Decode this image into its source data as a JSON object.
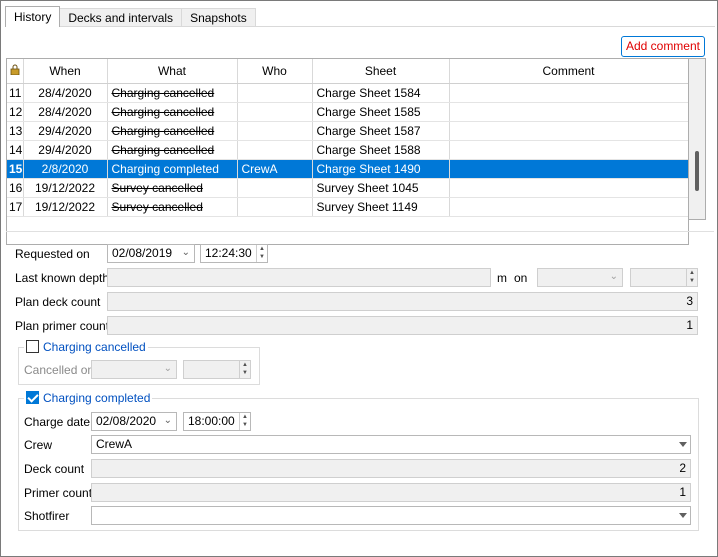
{
  "tabs": [
    {
      "label": "History",
      "active": true
    },
    {
      "label": "Decks and intervals",
      "active": false
    },
    {
      "label": "Snapshots",
      "active": false
    }
  ],
  "add_comment_label": "Add comment",
  "grid": {
    "columns": [
      "When",
      "What",
      "Who",
      "Sheet",
      "Comment"
    ],
    "rows": [
      {
        "num": "11",
        "when": "28/4/2020",
        "what": "Charging cancelled",
        "who": "",
        "sheet": "Charge Sheet 1584",
        "comment": "",
        "strike": true,
        "selected": false
      },
      {
        "num": "12",
        "when": "28/4/2020",
        "what": "Charging cancelled",
        "who": "",
        "sheet": "Charge Sheet 1585",
        "comment": "",
        "strike": true,
        "selected": false
      },
      {
        "num": "13",
        "when": "29/4/2020",
        "what": "Charging cancelled",
        "who": "",
        "sheet": "Charge Sheet 1587",
        "comment": "",
        "strike": true,
        "selected": false
      },
      {
        "num": "14",
        "when": "29/4/2020",
        "what": "Charging cancelled",
        "who": "",
        "sheet": "Charge Sheet 1588",
        "comment": "",
        "strike": true,
        "selected": false
      },
      {
        "num": "15",
        "when": "2/8/2020",
        "what": "Charging completed",
        "who": "CrewA",
        "sheet": "Charge Sheet 1490",
        "comment": "",
        "strike": false,
        "selected": true
      },
      {
        "num": "16",
        "when": "19/12/2022",
        "what": "Survey cancelled",
        "who": "",
        "sheet": "Survey Sheet 1045",
        "comment": "",
        "strike": true,
        "selected": false
      },
      {
        "num": "17",
        "when": "19/12/2022",
        "what": "Survey cancelled",
        "who": "",
        "sheet": "Survey Sheet 1149",
        "comment": "",
        "strike": true,
        "selected": false
      }
    ]
  },
  "form": {
    "requested_on_label": "Requested on",
    "requested_date": "02/08/2019",
    "requested_time": "12:24:30",
    "last_known_depth_label": "Last known depth",
    "depth_value": "",
    "m_label": "m",
    "on_label": "on",
    "plan_deck_count_label": "Plan deck count",
    "plan_deck_count": "3",
    "plan_primer_count_label": "Plan primer count",
    "plan_primer_count": "1",
    "charging_cancelled_label": "Charging cancelled",
    "cancelled_on_label": "Cancelled on",
    "charging_completed_label": "Charging completed",
    "charge_date_label": "Charge date",
    "charge_date": "02/08/2020",
    "charge_time": "18:00:00",
    "crew_label": "Crew",
    "crew_value": "CrewA",
    "deck_count_label": "Deck count",
    "deck_count": "2",
    "primer_count_label": "Primer count",
    "primer_count": "1",
    "shotfirer_label": "Shotfirer",
    "shotfirer_value": ""
  },
  "colors": {
    "accent": "#0078d7",
    "link_red": "#e00000",
    "group_label": "#0050c0"
  }
}
